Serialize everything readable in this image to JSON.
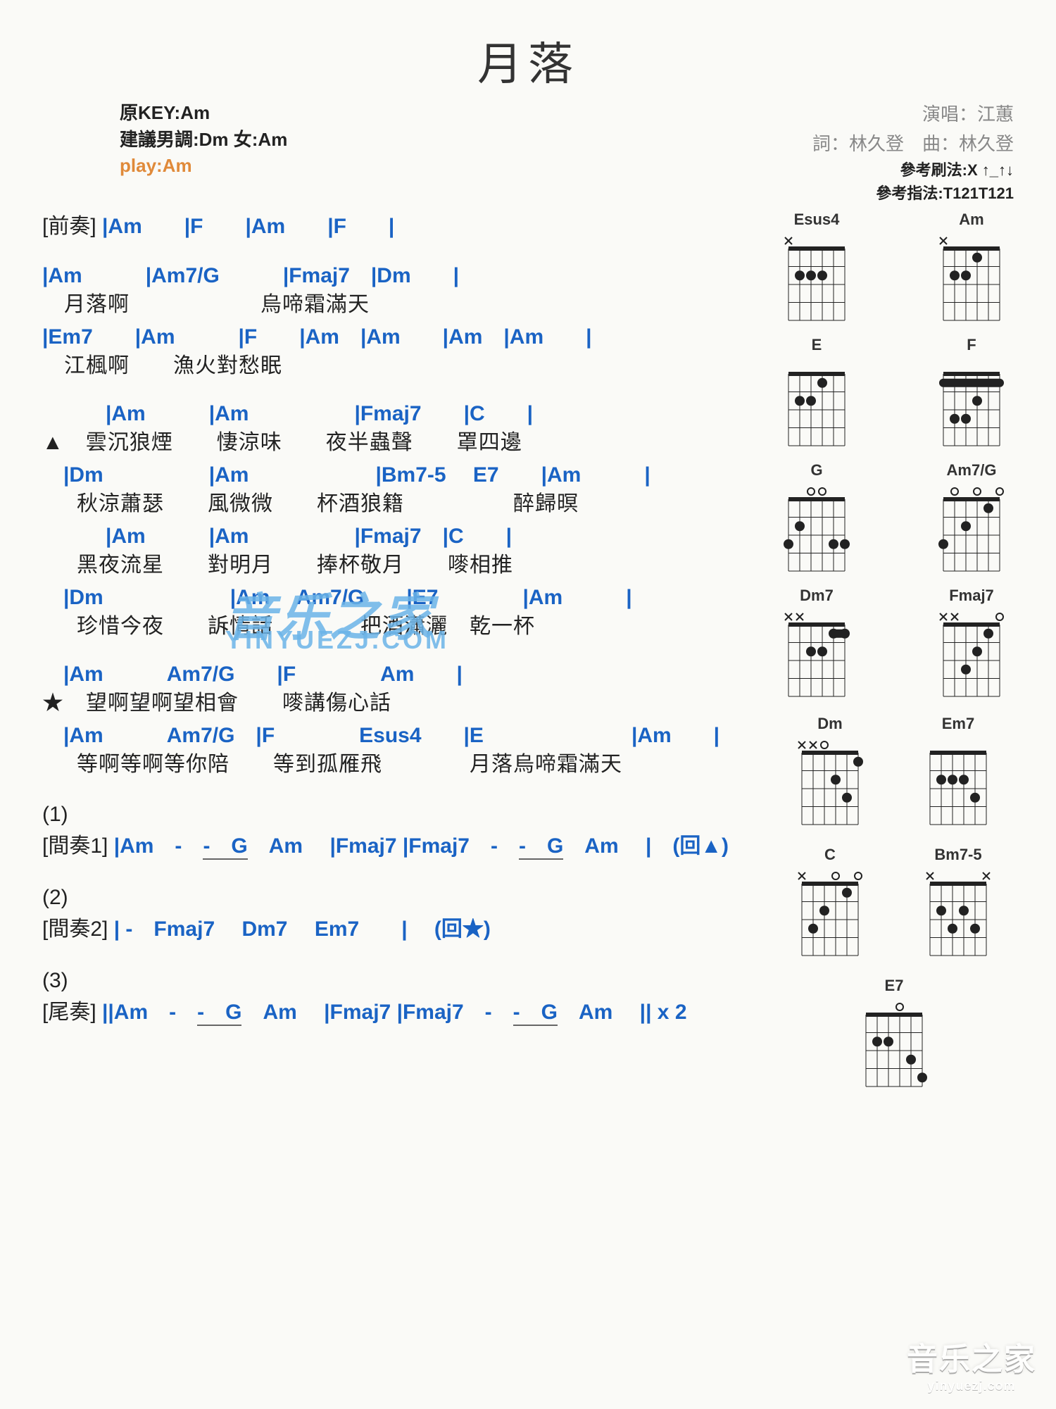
{
  "title": "月落",
  "key_info": {
    "orig": "原KEY:Am",
    "suggest": "建議男調:Dm 女:Am",
    "play": "play:Am"
  },
  "credits": {
    "singer": "演唱：江蕙",
    "lyricist": "詞：林久登　曲：林久登"
  },
  "ref": {
    "strum": "參考刷法:X ↑_↑↓",
    "finger": "參考指法:T121T121"
  },
  "intro": {
    "label": "[前奏]",
    "chords": "|Am　　|F　　|Am　　|F　　|"
  },
  "verse1": [
    {
      "chords": "|Am　　　|Am7/G　　　|Fmaj7　|Dm　　|",
      "lyric": "　月落啊　　　　　　烏啼霜滿天"
    },
    {
      "chords": "|Em7　　|Am　　　|F　　|Am　|Am　　|Am　|Am　　|",
      "lyric": "　江楓啊　　漁火對愁眠"
    }
  ],
  "sectionA": {
    "marker": "▲",
    "lines": [
      {
        "chords": "　　　|Am　　　|Am　　　　　|Fmaj7　　|C　　|",
        "lyric": "　雲沉狼煙　　悽涼味　　夜半蟲聲　　罩四邊"
      },
      {
        "chords": "　|Dm　　　　　|Am　　　　　　|Bm7-5　 E7　　|Am　　　|",
        "lyric": "　秋涼蕭瑟　　風微微　　杯酒狼籍　　　　　醉歸暝"
      },
      {
        "chords": "　　　|Am　　　|Am　　　　　|Fmaj7　|C　　|",
        "lyric": "　黑夜流星　　對明月　　捧杯敬月　　嘜相推"
      },
      {
        "chords": "　|Dm　　　　　　|Am　 Am7/G　　|E7　　　　|Am　　　|",
        "lyric": "　珍惜今夜　　訴情話　　　　把酒瀟灑　乾一杯"
      }
    ]
  },
  "sectionB": {
    "marker": "★",
    "lines": [
      {
        "chords": "　|Am　　　Am7/G　　|F　　　　Am　　|",
        "lyric": "　望啊望啊望相會　　嘜講傷心話"
      },
      {
        "chords": "　|Am　　　Am7/G　|F　　　　Esus4　　|E　　　　　　　|Am　　|",
        "lyric": "　等啊等啊等你陪　　等到孤雁飛　　　　月落烏啼霜滿天"
      }
    ]
  },
  "inter1": {
    "num": "(1)",
    "label": "[間奏1]",
    "text1": "|Am　-　",
    "u1": "-　G",
    "text2": "　Am　 |Fmaj7 |Fmaj7　-　",
    "u2": "-　G",
    "text3": "　Am　 |　(回▲)"
  },
  "inter2": {
    "num": "(2)",
    "label": "[間奏2]",
    "text": "| -　Fmaj7　 Dm7　 Em7　　|　 (回★)"
  },
  "outro": {
    "num": "(3)",
    "label": "[尾奏]",
    "text1": "||Am　-　",
    "u1": "-　G",
    "text2": "　Am　 |Fmaj7 |Fmaj7　-　",
    "u2": "-　G",
    "text3": "　Am　 || x 2"
  },
  "watermark": {
    "main": "音乐之家",
    "sub": "YINYUEZJ.COM"
  },
  "wm_br": {
    "main": "音乐之家",
    "sub": "yinyuezj.com"
  },
  "diagrams": [
    {
      "name": "Esus4",
      "marks": [
        "x",
        null,
        null,
        null,
        null,
        null
      ],
      "dots": [
        [
          2,
          2
        ],
        [
          3,
          2
        ],
        [
          4,
          2
        ]
      ]
    },
    {
      "name": "Am",
      "marks": [
        "x",
        null,
        null,
        null,
        null,
        null
      ],
      "dots": [
        [
          2,
          2
        ],
        [
          3,
          2
        ],
        [
          4,
          1
        ]
      ]
    },
    {
      "name": "E",
      "marks": [
        null,
        null,
        null,
        null,
        null,
        null
      ],
      "dots": [
        [
          2,
          2
        ],
        [
          3,
          2
        ],
        [
          4,
          1
        ]
      ]
    },
    {
      "name": "F",
      "barre": 1,
      "dots": [
        [
          2,
          3
        ],
        [
          3,
          3
        ],
        [
          4,
          2
        ]
      ]
    },
    {
      "name": "G",
      "marks": [
        null,
        null,
        "o",
        "o",
        null,
        null
      ],
      "dots": [
        [
          1,
          3
        ],
        [
          2,
          2
        ],
        [
          5,
          3
        ],
        [
          6,
          3
        ]
      ]
    },
    {
      "name": "Am7/G",
      "marks": [
        null,
        "o",
        null,
        "o",
        null,
        "o"
      ],
      "dots": [
        [
          1,
          3
        ],
        [
          3,
          2
        ],
        [
          5,
          1
        ]
      ]
    },
    {
      "name": "Dm7",
      "marks": [
        "x",
        "x",
        null,
        null,
        null,
        null
      ],
      "dots": [
        [
          3,
          2
        ],
        [
          4,
          2
        ],
        [
          5,
          1
        ],
        [
          6,
          1
        ]
      ],
      "barre_partial": [
        5,
        6,
        1
      ]
    },
    {
      "name": "Fmaj7",
      "marks": [
        "x",
        "x",
        null,
        null,
        null,
        "o"
      ],
      "dots": [
        [
          3,
          3
        ],
        [
          4,
          2
        ],
        [
          5,
          1
        ]
      ]
    },
    {
      "name": "Dm",
      "marks": [
        "x",
        "x",
        "o",
        null,
        null,
        null
      ],
      "dots": [
        [
          4,
          2
        ],
        [
          5,
          3
        ],
        [
          6,
          1
        ]
      ]
    },
    {
      "name": "Em7",
      "marks": [
        null,
        null,
        null,
        null,
        null,
        null
      ],
      "dots": [
        [
          2,
          2
        ],
        [
          3,
          2
        ],
        [
          4,
          2
        ],
        [
          5,
          3
        ]
      ]
    },
    {
      "name": "C",
      "marks": [
        "x",
        null,
        null,
        "o",
        null,
        "o"
      ],
      "dots": [
        [
          2,
          3
        ],
        [
          3,
          2
        ],
        [
          5,
          1
        ]
      ]
    },
    {
      "name": "Bm7-5",
      "marks": [
        "x",
        null,
        null,
        null,
        null,
        "x"
      ],
      "dots": [
        [
          2,
          2
        ],
        [
          3,
          3
        ],
        [
          4,
          2
        ],
        [
          5,
          3
        ]
      ]
    },
    {
      "name": "E7",
      "marks": [
        null,
        null,
        null,
        "o",
        null,
        null
      ],
      "dots": [
        [
          2,
          2
        ],
        [
          3,
          2
        ],
        [
          5,
          3
        ],
        [
          6,
          4
        ]
      ]
    }
  ]
}
